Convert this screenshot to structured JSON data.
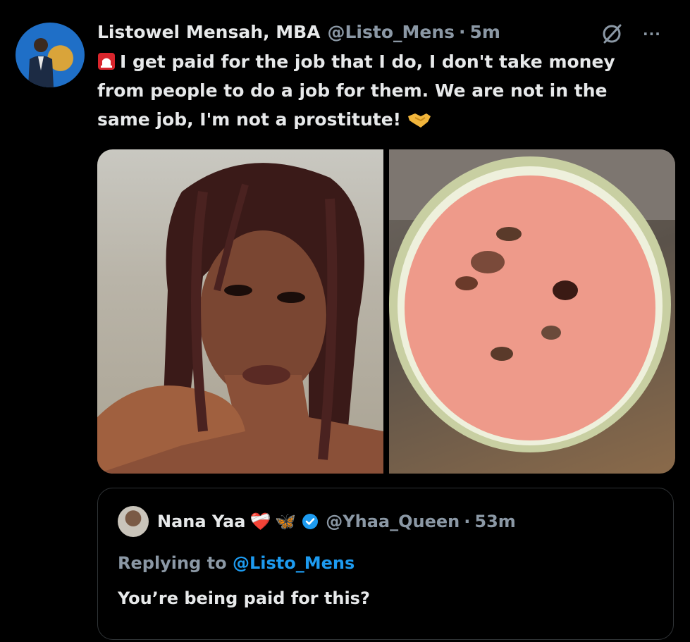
{
  "tweet": {
    "author_name": "Listowel Mensah, MBA",
    "handle": "@Listo_Mens",
    "separator": "·",
    "time": "5m",
    "more_label": "···",
    "text": "I get paid for the job that I do, I don't take money from people to do a job for them. We are not in the same job, I'm not a prostitute!",
    "lead_icon": "siren-icon",
    "trail_icon": "handshake-icon",
    "media": [
      {
        "kind": "photo",
        "subject": "woman-portrait"
      },
      {
        "kind": "photo",
        "subject": "watermelon-half"
      }
    ]
  },
  "quoted": {
    "author_name": "Nana Yaa",
    "emojis": [
      "❤️‍🩹",
      "🦋"
    ],
    "verified": true,
    "handle": "@Yhaa_Queen",
    "separator": "·",
    "time": "53m",
    "reply_prefix": "Replying to",
    "reply_mention": "@Listo_Mens",
    "text": "You’re being paid for this?"
  },
  "colors": {
    "background": "#000000",
    "text_primary": "#e7e9ea",
    "text_secondary": "#8b98a5",
    "link": "#1d9bf0",
    "border": "#2f3336"
  }
}
